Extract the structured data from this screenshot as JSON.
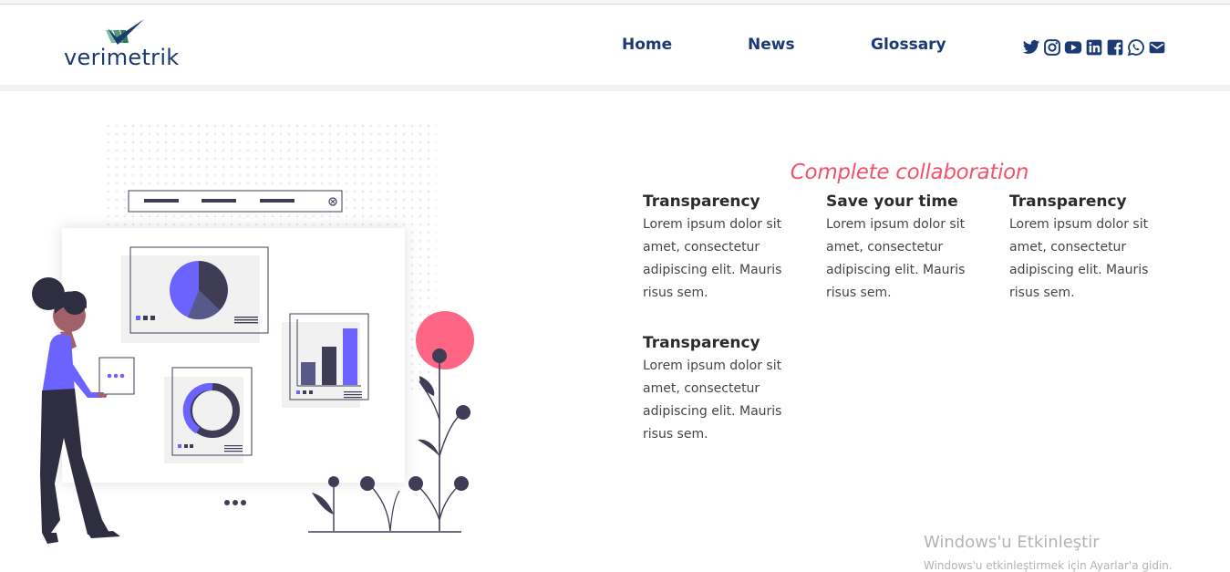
{
  "header": {
    "logo_text": "verimetrik",
    "nav": [
      {
        "label": "Home"
      },
      {
        "label": "News"
      },
      {
        "label": "Glossary"
      }
    ],
    "socials": [
      "twitter-icon",
      "instagram-icon",
      "youtube-icon",
      "linkedin-icon",
      "facebook-icon",
      "whatsapp-icon",
      "mail-icon"
    ]
  },
  "main": {
    "title": "Complete collaboration",
    "features": [
      {
        "title": "Transparency",
        "text": "Lorem ipsum dolor sit amet, consectetur adipiscing elit. Mauris risus sem."
      },
      {
        "title": "Save your time",
        "text": "Lorem ipsum dolor sit amet, consectetur adipiscing elit. Mauris risus sem."
      },
      {
        "title": "Transparency",
        "text": "Lorem ipsum dolor sit amet, consectetur adipiscing elit. Mauris risus sem."
      },
      {
        "title": "Transparency",
        "text": "Lorem ipsum dolor sit amet, consectetur adipiscing elit. Mauris risus sem."
      }
    ]
  },
  "watermark": {
    "title": "Windows'u Etkinleştir",
    "subtitle": "Windows'u etkinleştirmek için Ayarlar'a gidin."
  },
  "colors": {
    "brand_navy": "#1b3a73",
    "accent_pink": "#f0546c",
    "purple": "#6c63ff",
    "dark": "#3f3d56"
  }
}
